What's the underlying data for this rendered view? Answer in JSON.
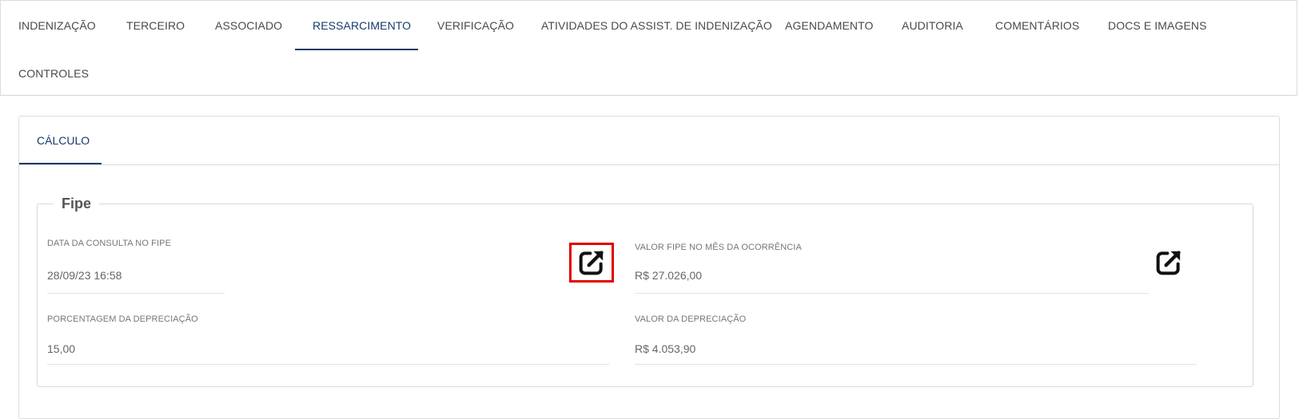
{
  "tabs": [
    {
      "label": "INDENIZAÇÃO"
    },
    {
      "label": "TERCEIRO"
    },
    {
      "label": "ASSOCIADO"
    },
    {
      "label": "RESSARCIMENTO"
    },
    {
      "label": "VERIFICAÇÃO"
    },
    {
      "label": "ATIVIDADES DO ASSIST. DE INDENIZAÇÃO"
    },
    {
      "label": "AGENDAMENTO"
    },
    {
      "label": "AUDITORIA"
    },
    {
      "label": "COMENTÁRIOS"
    },
    {
      "label": "DOCS E IMAGENS"
    },
    {
      "label": "CONTROLES"
    }
  ],
  "active_tab": "RESSARCIMENTO",
  "subtabs": [
    {
      "label": "CÁLCULO"
    }
  ],
  "fipe": {
    "legend": "Fipe",
    "data_consulta_label": "DATA DA CONSULTA NO FIPE",
    "data_consulta_value": "28/09/23 16:58",
    "valor_fipe_label": "VALOR FIPE NO MÊS DA OCORRÊNCIA",
    "valor_fipe_value": "R$ 27.026,00",
    "porcentagem_label": "PORCENTAGEM DA DEPRECIAÇÃO",
    "porcentagem_value": "15,00",
    "valor_depreciacao_label": "VALOR DA DEPRECIAÇÃO",
    "valor_depreciacao_value": "R$ 4.053,90",
    "icons": [
      "external-link-icon",
      "external-link-icon"
    ]
  },
  "colors": {
    "accent": "#173a6b",
    "highlight": "#e00000"
  }
}
